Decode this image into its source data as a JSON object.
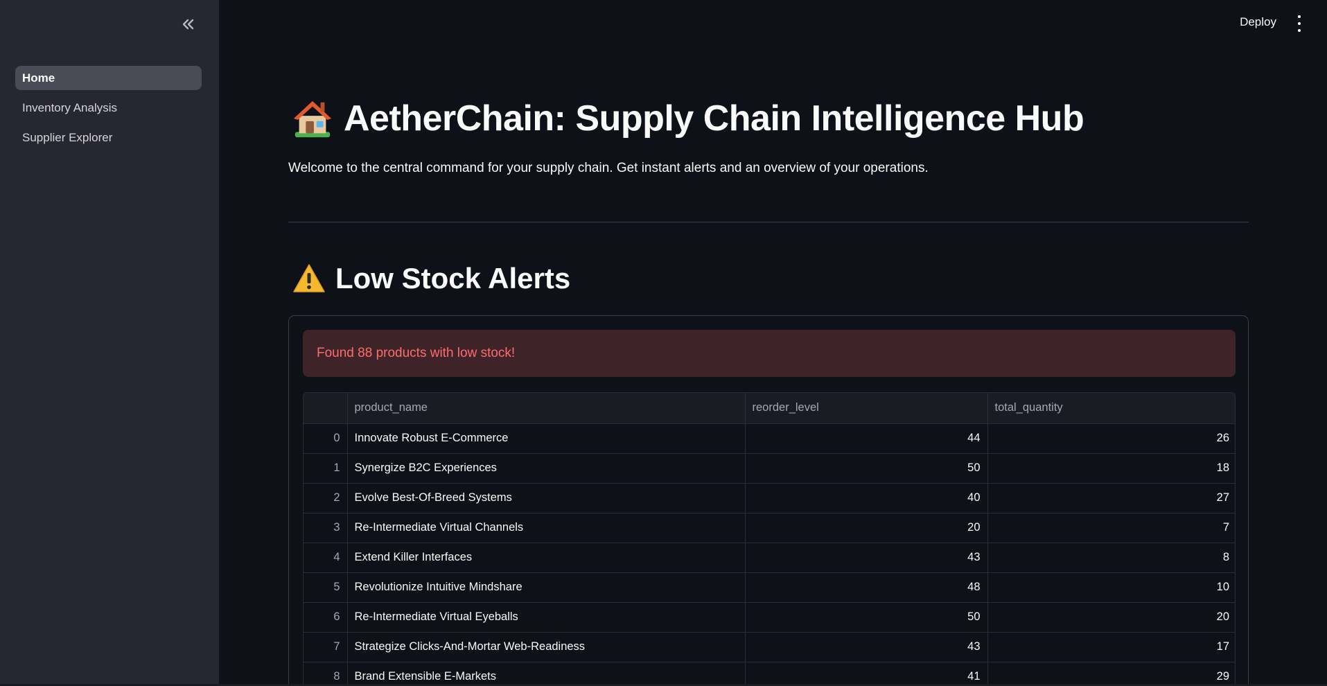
{
  "sidebar": {
    "items": [
      {
        "label": "Home"
      },
      {
        "label": "Inventory Analysis"
      },
      {
        "label": "Supplier Explorer"
      }
    ]
  },
  "header": {
    "deploy_label": "Deploy"
  },
  "main": {
    "title": "AetherChain: Supply Chain Intelligence Hub",
    "subtitle": "Welcome to the central command for your supply chain. Get instant alerts and an overview of your operations.",
    "section_title": "Low Stock Alerts",
    "alert_text": "Found 88 products with low stock!"
  },
  "table": {
    "columns": [
      "",
      "product_name",
      "reorder_level",
      "total_quantity"
    ],
    "rows": [
      {
        "idx": "0",
        "product_name": "Innovate Robust E-Commerce",
        "reorder_level": "44",
        "total_quantity": "26"
      },
      {
        "idx": "1",
        "product_name": "Synergize B2C Experiences",
        "reorder_level": "50",
        "total_quantity": "18"
      },
      {
        "idx": "2",
        "product_name": "Evolve Best-Of-Breed Systems",
        "reorder_level": "40",
        "total_quantity": "27"
      },
      {
        "idx": "3",
        "product_name": "Re-Intermediate Virtual Channels",
        "reorder_level": "20",
        "total_quantity": "7"
      },
      {
        "idx": "4",
        "product_name": "Extend Killer Interfaces",
        "reorder_level": "43",
        "total_quantity": "8"
      },
      {
        "idx": "5",
        "product_name": "Revolutionize Intuitive Mindshare",
        "reorder_level": "48",
        "total_quantity": "10"
      },
      {
        "idx": "6",
        "product_name": "Re-Intermediate Virtual Eyeballs",
        "reorder_level": "50",
        "total_quantity": "20"
      },
      {
        "idx": "7",
        "product_name": "Strategize Clicks-And-Mortar Web-Readiness",
        "reorder_level": "43",
        "total_quantity": "17"
      },
      {
        "idx": "8",
        "product_name": "Brand Extensible E-Markets",
        "reorder_level": "41",
        "total_quantity": "29"
      }
    ]
  },
  "colors": {
    "background": "#0e1117",
    "sidebar": "#262730",
    "alert_bg": "#3e2428",
    "alert_text": "#ff6c6c"
  },
  "icons": {
    "collapse": "double-chevron-left-icon",
    "menu": "kebab-menu-icon",
    "title": "house-emoji-icon",
    "section": "warning-emoji-icon"
  }
}
